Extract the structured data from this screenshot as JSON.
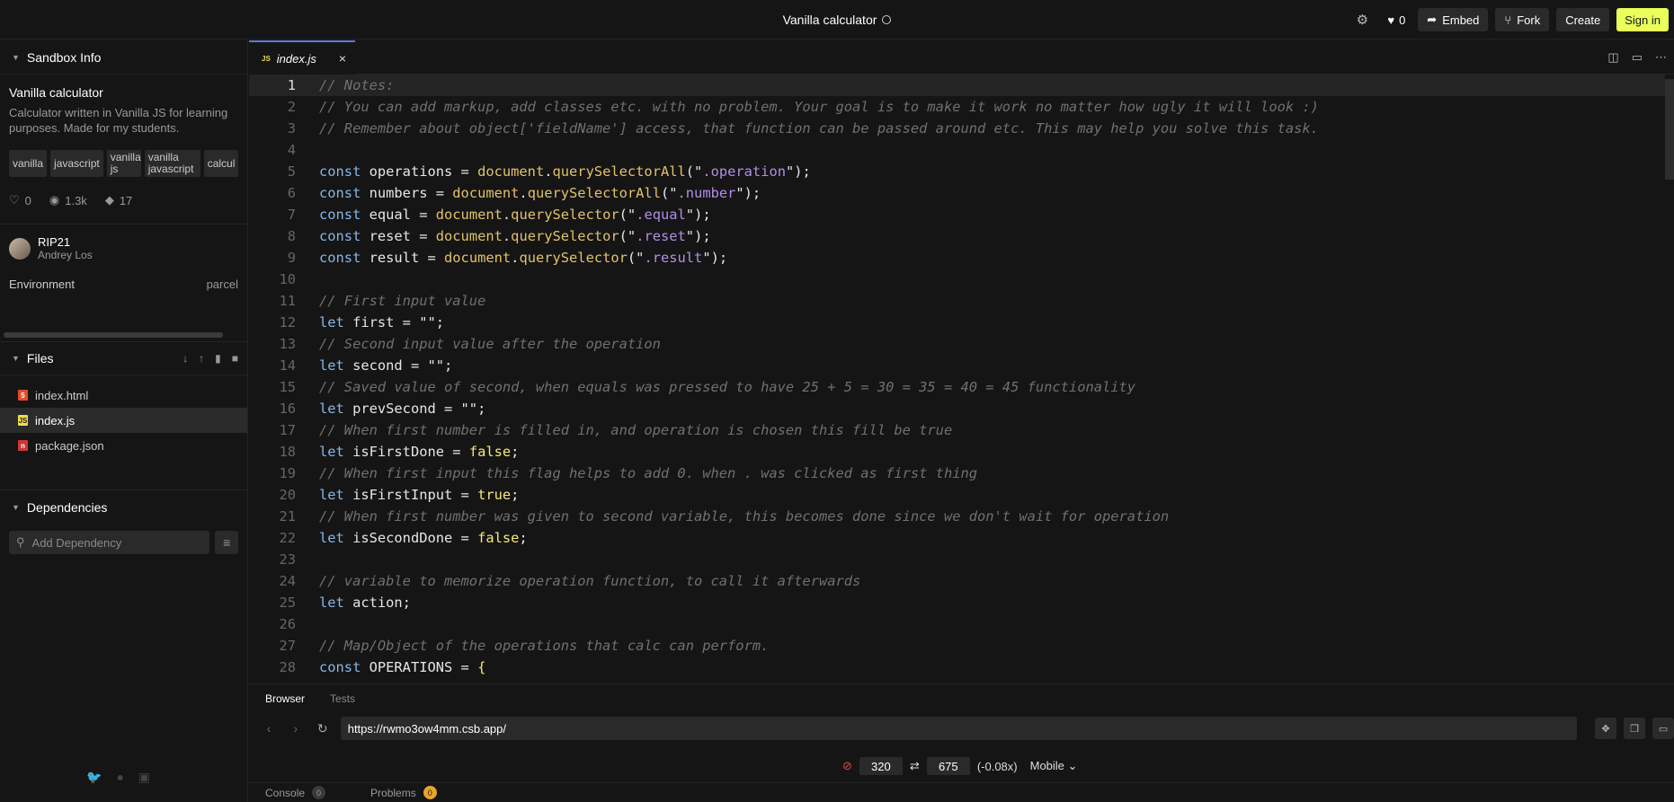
{
  "header": {
    "title": "Vanilla calculator",
    "like_count": "0",
    "embed_label": "Embed",
    "fork_label": "Fork",
    "create_label": "Create",
    "signin_label": "Sign in",
    "accent_color": "#e9ff5a"
  },
  "sidebar": {
    "section_title": "Sandbox Info",
    "sandbox_name": "Vanilla calculator",
    "description": "Calculator written in Vanilla JS for learning purposes. Made for my students.",
    "tags": [
      "vanilla",
      "javascript",
      "vanilla js",
      "vanilla javascript",
      "calcul"
    ],
    "stats": {
      "likes": "0",
      "views": "1.3k",
      "forks": "17"
    },
    "author": {
      "nick": "RIP21",
      "name": "Andrey Los"
    },
    "environment": {
      "label": "Environment",
      "value": "parcel"
    },
    "files_title": "Files",
    "files": [
      {
        "name": "index.html",
        "icon": "html-file-icon"
      },
      {
        "name": "index.js",
        "icon": "js-file-icon",
        "active": true
      },
      {
        "name": "package.json",
        "icon": "npm-file-icon"
      }
    ],
    "dependencies_title": "Dependencies",
    "add_dependency_placeholder": "Add Dependency"
  },
  "editor": {
    "tab_label": "index.js",
    "tab_icon": "JS",
    "current_line": 1,
    "lines": [
      [
        [
          "c",
          "// Notes:"
        ]
      ],
      [
        [
          "c",
          "// You can add markup, add classes etc. with no problem. Your goal is to make it work no matter how ugly it will look :)"
        ]
      ],
      [
        [
          "c",
          "// Remember about object['fieldName'] access, that function can be passed around etc. This may help you solve this task."
        ]
      ],
      [],
      [
        [
          "k",
          "const"
        ],
        [
          "t",
          " operations = "
        ],
        [
          "f",
          "document"
        ],
        [
          "t",
          "."
        ],
        [
          "f",
          "querySelectorAll"
        ],
        [
          "t",
          "(\""
        ],
        [
          "sv",
          ".operation"
        ],
        [
          "t",
          "\");"
        ]
      ],
      [
        [
          "k",
          "const"
        ],
        [
          "t",
          " numbers = "
        ],
        [
          "f",
          "document"
        ],
        [
          "t",
          "."
        ],
        [
          "f",
          "querySelectorAll"
        ],
        [
          "t",
          "(\""
        ],
        [
          "sv",
          ".number"
        ],
        [
          "t",
          "\");"
        ]
      ],
      [
        [
          "k",
          "const"
        ],
        [
          "t",
          " equal = "
        ],
        [
          "f",
          "document"
        ],
        [
          "t",
          "."
        ],
        [
          "f",
          "querySelector"
        ],
        [
          "t",
          "(\""
        ],
        [
          "sv",
          ".equal"
        ],
        [
          "t",
          "\");"
        ]
      ],
      [
        [
          "k",
          "const"
        ],
        [
          "t",
          " reset = "
        ],
        [
          "f",
          "document"
        ],
        [
          "t",
          "."
        ],
        [
          "f",
          "querySelector"
        ],
        [
          "t",
          "(\""
        ],
        [
          "sv",
          ".reset"
        ],
        [
          "t",
          "\");"
        ]
      ],
      [
        [
          "k",
          "const"
        ],
        [
          "t",
          " result = "
        ],
        [
          "f",
          "document"
        ],
        [
          "t",
          "."
        ],
        [
          "f",
          "querySelector"
        ],
        [
          "t",
          "(\""
        ],
        [
          "sv",
          ".result"
        ],
        [
          "t",
          "\");"
        ]
      ],
      [],
      [
        [
          "c",
          "// First input value"
        ]
      ],
      [
        [
          "k",
          "let"
        ],
        [
          "t",
          " first = \"\";"
        ]
      ],
      [
        [
          "c",
          "// Second input value after the operation"
        ]
      ],
      [
        [
          "k",
          "let"
        ],
        [
          "t",
          " second = \"\";"
        ]
      ],
      [
        [
          "c",
          "// Saved value of second, when equals was pressed to have 25 + 5 = 30 = 35 = 40 = 45 functionality"
        ]
      ],
      [
        [
          "k",
          "let"
        ],
        [
          "t",
          " prevSecond = \"\";"
        ]
      ],
      [
        [
          "c",
          "// When first number is filled in, and operation is chosen this fill be true"
        ]
      ],
      [
        [
          "k",
          "let"
        ],
        [
          "t",
          " isFirstDone = "
        ],
        [
          "b",
          "false"
        ],
        [
          "t",
          ";"
        ]
      ],
      [
        [
          "c",
          "// When first input this flag helps to add 0. when . was clicked as first thing"
        ]
      ],
      [
        [
          "k",
          "let"
        ],
        [
          "t",
          " isFirstInput = "
        ],
        [
          "b",
          "true"
        ],
        [
          "t",
          ";"
        ]
      ],
      [
        [
          "c",
          "// When first number was given to second variable, this becomes done since we don't wait for operation"
        ]
      ],
      [
        [
          "k",
          "let"
        ],
        [
          "t",
          " isSecondDone = "
        ],
        [
          "b",
          "false"
        ],
        [
          "t",
          ";"
        ]
      ],
      [],
      [
        [
          "c",
          "// variable to memorize operation function, to call it afterwards"
        ]
      ],
      [
        [
          "k",
          "let"
        ],
        [
          "t",
          " action;"
        ]
      ],
      [],
      [
        [
          "c",
          "// Map/Object of the operations that calc can perform."
        ]
      ],
      [
        [
          "k",
          "const"
        ],
        [
          "t",
          " OPERATIONS = "
        ],
        [
          "b",
          "{"
        ]
      ]
    ]
  },
  "browser": {
    "tabs": [
      "Browser",
      "Tests"
    ],
    "url": "https://rwmo3ow4mm.csb.app/",
    "width": "320",
    "height": "675",
    "scale": "(-0.08x)",
    "device": "Mobile"
  },
  "status": {
    "console_label": "Console",
    "console_count": "0",
    "problems_label": "Problems",
    "problems_count": "0"
  }
}
